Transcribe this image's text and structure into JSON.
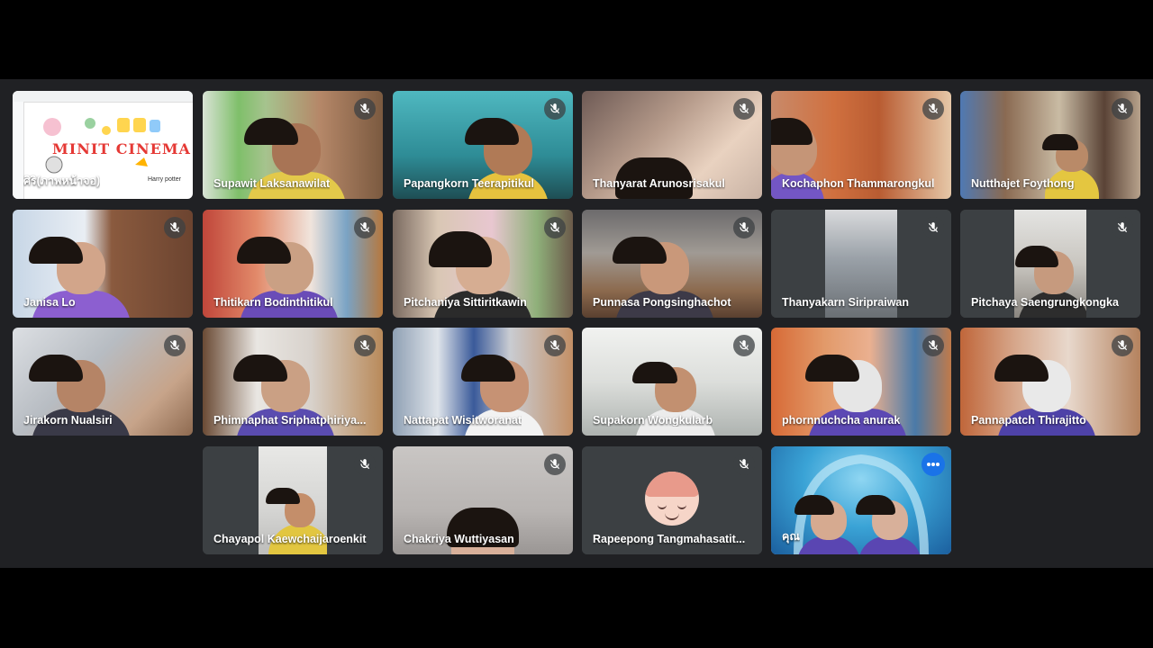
{
  "meeting": {
    "participants": [
      {
        "name": "ศิริ(ภาพหน้าจอ)",
        "kind": "presentation"
      },
      {
        "name": "Supawit Laksanawilat",
        "kind": "video",
        "muted": true
      },
      {
        "name": "Papangkorn Teerapitikul",
        "kind": "video",
        "muted": true
      },
      {
        "name": "Thanyarat Arunosrisakul",
        "kind": "video",
        "muted": true
      },
      {
        "name": "Kochaphon Thammarongkul",
        "kind": "video",
        "muted": true
      },
      {
        "name": "Nutthajet Foythong",
        "kind": "video",
        "muted": true
      },
      {
        "name": "Janisa Lo",
        "kind": "video",
        "muted": true
      },
      {
        "name": "Thitikarn Bodinthitikul",
        "kind": "video",
        "muted": true
      },
      {
        "name": "Pitchaniya Sittiritkawin",
        "kind": "video",
        "muted": true
      },
      {
        "name": "Punnasa Pongsinghachot",
        "kind": "video",
        "muted": true
      },
      {
        "name": "Thanyakarn Siripraiwan",
        "kind": "video",
        "muted": true
      },
      {
        "name": "Pitchaya Saengrungkongka",
        "kind": "video",
        "muted": true
      },
      {
        "name": "Jirakorn Nualsiri",
        "kind": "video",
        "muted": true
      },
      {
        "name": "Phimnaphat Sriphatphiriya...",
        "kind": "video",
        "muted": true
      },
      {
        "name": "Nattapat Wisitworanat",
        "kind": "video",
        "muted": true
      },
      {
        "name": "Supakorn Wongkularb",
        "kind": "video",
        "muted": true
      },
      {
        "name": "phornnuchcha anurak",
        "kind": "video",
        "muted": true
      },
      {
        "name": "Pannapatch Thirajitto",
        "kind": "video",
        "muted": true
      },
      {
        "name": "Chayapol Kaewchaijaroenkit",
        "kind": "video",
        "muted": true
      },
      {
        "name": "Chakriya Wuttiyasan",
        "kind": "video",
        "muted": true
      },
      {
        "name": "Rapeepong Tangmahasatit...",
        "kind": "avatar",
        "muted": true
      },
      {
        "name": "คุณ",
        "kind": "self",
        "muted": false
      }
    ],
    "presentation_text": {
      "title": "MINIT CINEMA",
      "caption": "Harry potter"
    },
    "colors": {
      "stage": "#202124",
      "tile": "#3c4043",
      "accent": "#1a73e8",
      "self_border": "#8ab4f8"
    }
  }
}
